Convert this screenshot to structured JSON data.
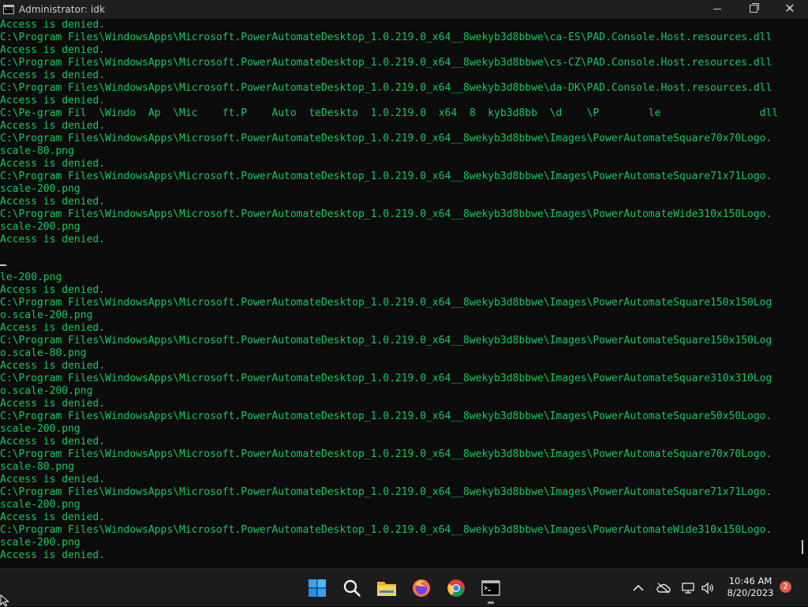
{
  "window": {
    "title": "Administrator:  idk",
    "icon": "cmd-icon"
  },
  "console": {
    "text_color": "#13c95d",
    "lines": [
      "Access is denied.",
      "C:\\Program Files\\WindowsApps\\Microsoft.PowerAutomateDesktop_1.0.219.0_x64__8wekyb3d8bbwe\\ca-ES\\PAD.Console.Host.resources.dll",
      "Access is denied.",
      "C:\\Program Files\\WindowsApps\\Microsoft.PowerAutomateDesktop_1.0.219.0_x64__8wekyb3d8bbwe\\cs-CZ\\PAD.Console.Host.resources.dll",
      "Access is denied.",
      "C:\\Program Files\\WindowsApps\\Microsoft.PowerAutomateDesktop_1.0.219.0_x64__8wekyb3d8bbwe\\da-DK\\PAD.Console.Host.resources.dll",
      "Access is denied.",
      "C:\\Pe-gram Fil  \\Windo  Ap  \\Mic    ft.P    Auto  teDeskto  1.0.219.0  x64  8  kyb3d8bb  \\d    \\P        le                dll",
      "Access is denied.",
      "C:\\Program Files\\WindowsApps\\Microsoft.PowerAutomateDesktop_1.0.219.0_x64__8wekyb3d8bbwe\\Images\\PowerAutomateSquare70x70Logo.",
      "scale-80.png",
      "Access is denied.",
      "C:\\Program Files\\WindowsApps\\Microsoft.PowerAutomateDesktop_1.0.219.0_x64__8wekyb3d8bbwe\\Images\\PowerAutomateSquare71x71Logo.",
      "scale-200.png",
      "Access is denied.",
      "C:\\Program Files\\WindowsApps\\Microsoft.PowerAutomateDesktop_1.0.219.0_x64__8wekyb3d8bbwe\\Images\\PowerAutomateWide310x150Logo.",
      "scale-200.png",
      "Access is denied.",
      "",
      "[cursor]",
      "le-200.png",
      "Access is denied.",
      "C:\\Program Files\\WindowsApps\\Microsoft.PowerAutomateDesktop_1.0.219.0_x64__8wekyb3d8bbwe\\Images\\PowerAutomateSquare150x150Log",
      "o.scale-200.png",
      "Access is denied.",
      "C:\\Program Files\\WindowsApps\\Microsoft.PowerAutomateDesktop_1.0.219.0_x64__8wekyb3d8bbwe\\Images\\PowerAutomateSquare150x150Log",
      "o.scale-80.png",
      "Access is denied.",
      "C:\\Program Files\\WindowsApps\\Microsoft.PowerAutomateDesktop_1.0.219.0_x64__8wekyb3d8bbwe\\Images\\PowerAutomateSquare310x310Log",
      "o.scale-200.png",
      "Access is denied.",
      "C:\\Program Files\\WindowsApps\\Microsoft.PowerAutomateDesktop_1.0.219.0_x64__8wekyb3d8bbwe\\Images\\PowerAutomateSquare50x50Logo.",
      "scale-200.png",
      "Access is denied.",
      "C:\\Program Files\\WindowsApps\\Microsoft.PowerAutomateDesktop_1.0.219.0_x64__8wekyb3d8bbwe\\Images\\PowerAutomateSquare70x70Logo.",
      "scale-80.png",
      "Access is denied.",
      "C:\\Program Files\\WindowsApps\\Microsoft.PowerAutomateDesktop_1.0.219.0_x64__8wekyb3d8bbwe\\Images\\PowerAutomateSquare71x71Logo.",
      "scale-200.png",
      "Access is denied.",
      "C:\\Program Files\\WindowsApps\\Microsoft.PowerAutomateDesktop_1.0.219.0_x64__8wekyb3d8bbwe\\Images\\PowerAutomateWide310x150Logo.",
      "scale-200.png",
      "Access is denied.",
      "",
      "[cursor]"
    ]
  },
  "taskbar": {
    "apps": [
      {
        "name": "start-button",
        "icon": "windows-logo-icon"
      },
      {
        "name": "search-button",
        "icon": "search-icon"
      },
      {
        "name": "file-explorer-button",
        "icon": "folder-icon"
      },
      {
        "name": "firefox-button",
        "icon": "firefox-icon"
      },
      {
        "name": "chrome-button",
        "icon": "chrome-icon"
      },
      {
        "name": "command-prompt-button",
        "icon": "cmd-icon"
      }
    ],
    "tray_icons": [
      "chevron-up-icon",
      "onedrive-offline-icon",
      "network-icon",
      "volume-icon"
    ],
    "clock": {
      "time": "10:46 AM",
      "date": "8/20/2023"
    },
    "notification_count": "2"
  }
}
